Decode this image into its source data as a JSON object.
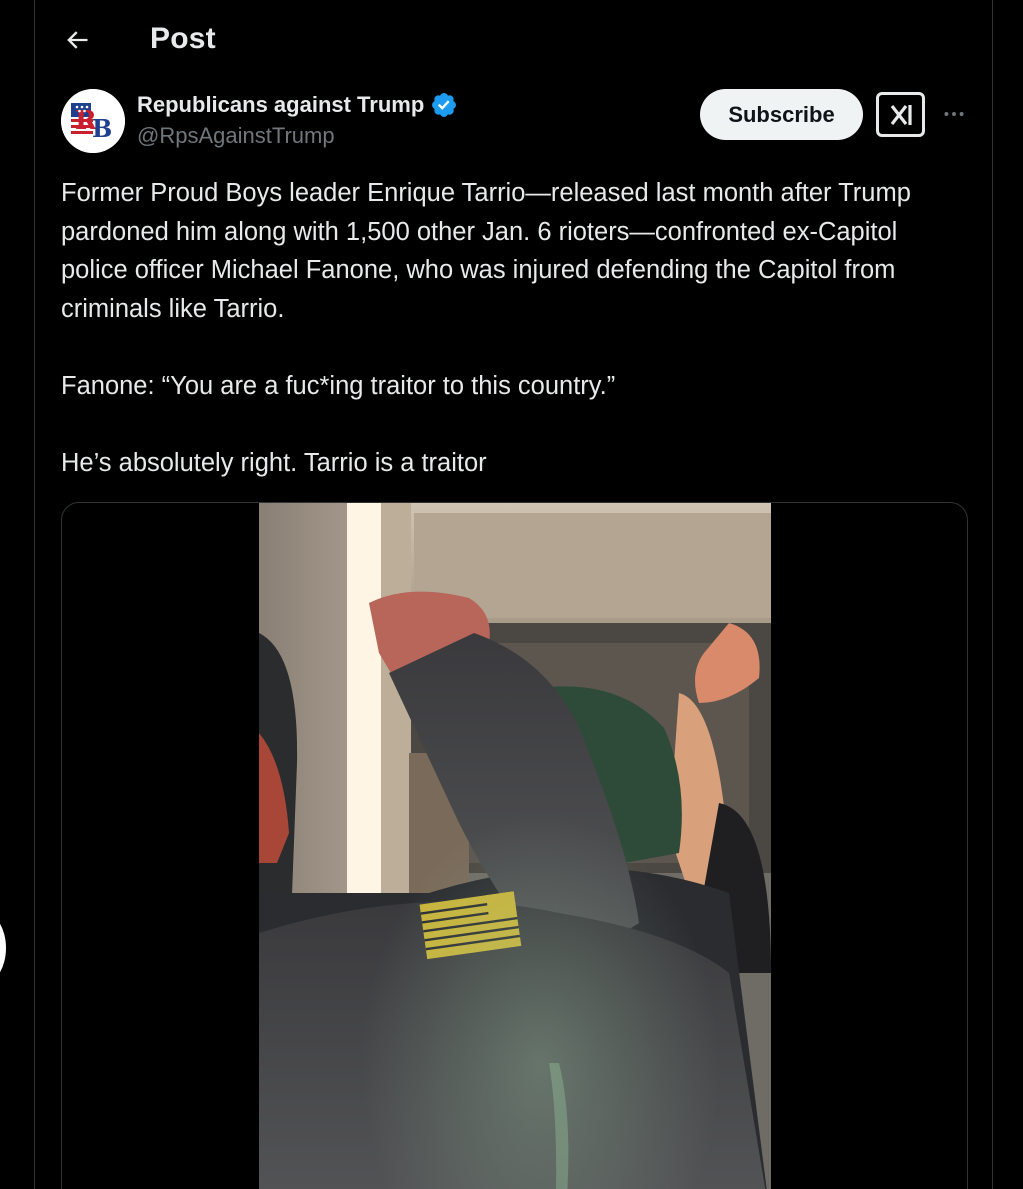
{
  "header": {
    "title": "Post",
    "back_icon": "arrow-left-icon"
  },
  "post": {
    "author": {
      "name": "Republicans against Trump",
      "handle": "@RpsAgainstTrump",
      "avatar_text": "RB",
      "verified_color": "#1d9bf0"
    },
    "subscribe_label": "Subscribe",
    "grok_icon": "grok-icon",
    "more_icon": "more-icon",
    "paragraphs": [
      "Former Proud Boys leader Enrique Tarrio—released last month after Trump pardoned him along with 1,500 other Jan. 6 rioters—confronted ex-Capitol police officer Michael Fanone, who was injured defending the Capitol from criminals like Tarrio.",
      "Fanone: “You are a fuc*ing traitor to this country.”",
      "He’s absolutely right. Tarrio is a traitor"
    ],
    "media": {
      "type": "video",
      "description_icon": "video-player"
    }
  },
  "colors": {
    "background": "#000000",
    "text_primary": "#e7e9ea",
    "text_secondary": "#71767b",
    "border": "#2f3336",
    "button_bg": "#eff3f4"
  }
}
